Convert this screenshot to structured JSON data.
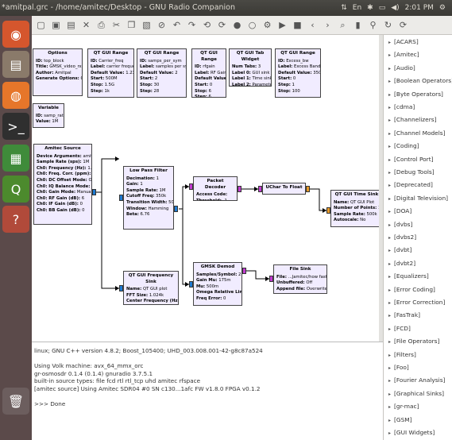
{
  "window": {
    "title": "*amitpal.grc - /home/amitec/Desktop - GNU Radio Companion",
    "tray": {
      "keyboard": "En",
      "time": "2:01 PM"
    }
  },
  "launcher": [
    {
      "name": "dash-icon",
      "glyph": "◉",
      "color": "#d5562d"
    },
    {
      "name": "files-icon",
      "glyph": "▤",
      "color": "#8a7a6a"
    },
    {
      "name": "firefox-icon",
      "glyph": "◍",
      "color": "#e6762a"
    },
    {
      "name": "terminal-icon",
      "glyph": ">_",
      "color": "#2f2f2f"
    },
    {
      "name": "libreoffice-icon",
      "glyph": "▦",
      "color": "#3f8b3a"
    },
    {
      "name": "gnuradio-icon",
      "glyph": "Q",
      "color": "#4c8a2d"
    },
    {
      "name": "help-icon",
      "glyph": "?",
      "color": "#b14a3a"
    },
    {
      "name": "trash-icon",
      "glyph": "🗑",
      "color": "#6c5e5e"
    }
  ],
  "toolbar": [
    "new",
    "open",
    "save",
    "close",
    "print",
    "cut",
    "copy",
    "paste",
    "delete",
    "undo",
    "redo",
    "rotate-ccw",
    "rotate-cw",
    "enable",
    "disable",
    "generate",
    "execute",
    "kill",
    "left",
    "right",
    "find",
    "flowgraph-kill",
    "zoom",
    "refresh",
    "reload"
  ],
  "blocks": {
    "options": {
      "title": "Options",
      "params": [
        [
          "ID:",
          "top_block"
        ],
        [
          "Title:",
          "GMSK_video_rx.sh"
        ],
        [
          "Author:",
          "Amitpal"
        ],
        [
          "Generate Options:",
          "QT GUI"
        ]
      ]
    },
    "variable": {
      "title": "Variable",
      "params": [
        [
          "ID:",
          "samp_rate"
        ],
        [
          "Value:",
          "1M"
        ]
      ]
    },
    "range1": {
      "title": "QT GUI Range",
      "params": [
        [
          "ID:",
          "Carrier_freq"
        ],
        [
          "Label:",
          "carrier frequency"
        ],
        [
          "Default Value:",
          "1.2345G"
        ],
        [
          "Start:",
          "500M"
        ],
        [
          "Stop:",
          "1.5G"
        ],
        [
          "Step:",
          "1k"
        ]
      ]
    },
    "range2": {
      "title": "QT GUI Range",
      "params": [
        [
          "ID:",
          "samps_per_sym"
        ],
        [
          "Label:",
          "samples per symbols"
        ],
        [
          "Default Value:",
          "2"
        ],
        [
          "Start:",
          "2"
        ],
        [
          "Stop:",
          "30"
        ],
        [
          "Step:",
          "28"
        ]
      ]
    },
    "range3": {
      "title": "QT GUI Range",
      "params": [
        [
          "ID:",
          "rfgain"
        ],
        [
          "Label:",
          "RF Gain"
        ],
        [
          "Default Value:",
          "6"
        ],
        [
          "Start:",
          "0"
        ],
        [
          "Stop:",
          "6"
        ],
        [
          "Step:",
          "6"
        ]
      ]
    },
    "tabw": {
      "title": "QT GUI Tab Widget",
      "params": [
        [
          "Num Tabs:",
          "3"
        ],
        [
          "Label 0:",
          "GUI sink"
        ],
        [
          "Label 1:",
          "Time sink"
        ],
        [
          "Label 2:",
          "Parameters"
        ]
      ]
    },
    "range4": {
      "title": "QT GUI Range",
      "params": [
        [
          "ID:",
          "Excess_bw"
        ],
        [
          "Label:",
          "Excess Bandwidth"
        ],
        [
          "Default Value:",
          "350m"
        ],
        [
          "Start:",
          "0"
        ],
        [
          "Step:",
          "1"
        ],
        [
          "Stop:",
          "100"
        ]
      ]
    },
    "source": {
      "title": "Amitec Source",
      "params": [
        [
          "Device Arguments:",
          "amitec"
        ],
        [
          "Sample Rate (sps):",
          "1M"
        ],
        [
          "Ch0: Frequency (Hz):",
          "1.2345G"
        ],
        [
          "Ch0: Freq. Corr. (ppm):",
          "0"
        ],
        [
          "Ch0: DC Offset Mode:",
          "Off"
        ],
        [
          "Ch0: IQ Balance Mode:",
          "Off"
        ],
        [
          "Ch0: Gain Mode:",
          "Manual"
        ],
        [
          "Ch0: RF Gain (dB):",
          "6"
        ],
        [
          "Ch0: IF Gain (dB):",
          "0"
        ],
        [
          "Ch0: BB Gain (dB):",
          "0"
        ]
      ]
    },
    "lpf": {
      "title": "Low Pass Filter",
      "params": [
        [
          "Decimation:",
          "1"
        ],
        [
          "Gain:",
          "1"
        ],
        [
          "Sample Rate:",
          "1M"
        ],
        [
          "Cutoff Freq:",
          "350k"
        ],
        [
          "Transition Width:",
          "50k"
        ],
        [
          "Window:",
          "Hamming"
        ],
        [
          "Beta:",
          "6.76"
        ]
      ]
    },
    "pktdec": {
      "title": "Packet Decoder",
      "params": [
        [
          "Access Code:",
          ""
        ],
        [
          "Threshold:",
          "-1"
        ]
      ]
    },
    "uchar": {
      "title": "UChar To Float",
      "params": []
    },
    "timesink": {
      "title": "QT GUI Time Sink",
      "params": [
        [
          "Name:",
          "QT GUI Plot"
        ],
        [
          "Number of Points:",
          "1.024k"
        ],
        [
          "Sample Rate:",
          "500k"
        ],
        [
          "Autoscale:",
          "No"
        ]
      ]
    },
    "freqsink": {
      "title": "QT GUI Frequency Sink",
      "params": [
        [
          "Name:",
          "QT GUI plot"
        ],
        [
          "FFT Size:",
          "1.024k"
        ],
        [
          "Center Frequency (Hz):",
          "0"
        ],
        [
          "Bandwidth (Hz):",
          "1M"
        ]
      ]
    },
    "gmsk": {
      "title": "GMSK Demod",
      "params": [
        [
          "Samples/Symbol:",
          "2"
        ],
        [
          "Gain Mu:",
          "175m"
        ],
        [
          "Mu:",
          "500m"
        ],
        [
          "Omega Relative Limit:",
          "5m"
        ],
        [
          "Freq Error:",
          "0"
        ]
      ]
    },
    "filesink": {
      "title": "File Sink",
      "params": [
        [
          "File:",
          "...Jamitec/how fast.ogg"
        ],
        [
          "Unbuffered:",
          "Off"
        ],
        [
          "Append file:",
          "Overwrite"
        ]
      ]
    }
  },
  "console": [
    "linux; GNU C++ version 4.8.2; Boost_105400; UHD_003.008.001-42-g8c87a524",
    "",
    "Using Volk machine: avx_64_mmx_orc",
    "gr-osmosdr 0.1.4 (0.1.4) gnuradio 3.7.5.1",
    "built-in source types: file fcd rtl rtl_tcp uhd amitec rfspace",
    "[amitec source] Using Amitec SDR04 #0 SN c130...1afc FW v1.8.0 FPGA v0.1.2",
    "",
    ">>> Done"
  ],
  "categories": [
    "[ACARS]",
    "[Amitec]",
    "[Audio]",
    "[Boolean Operators]",
    "[Byte Operators]",
    "[cdma]",
    "[Channelizers]",
    "[Channel Models]",
    "[Coding]",
    "[Control Port]",
    "[Debug Tools]",
    "[Deprecated]",
    "[Digital Television]",
    "[DOA]",
    "[dvbs]",
    "[dvbs2]",
    "[dvbt]",
    "[dvbt2]",
    "[Equalizers]",
    "[Error Coding]",
    "[Error Correction]",
    "[FasTrak]",
    "[FCD]",
    "[File Operators]",
    "[Filters]",
    "[Foo]",
    "[Fourier Analysis]",
    "[Graphical Sinks]",
    "[gr-mac]",
    "[GSM]",
    "[GUI Widgets]"
  ],
  "colors": {
    "block_bg": "#f1ecff",
    "complex_port": "#1f7ad1",
    "byte_port": "#c23bd1",
    "float_port": "#e79a2a"
  }
}
